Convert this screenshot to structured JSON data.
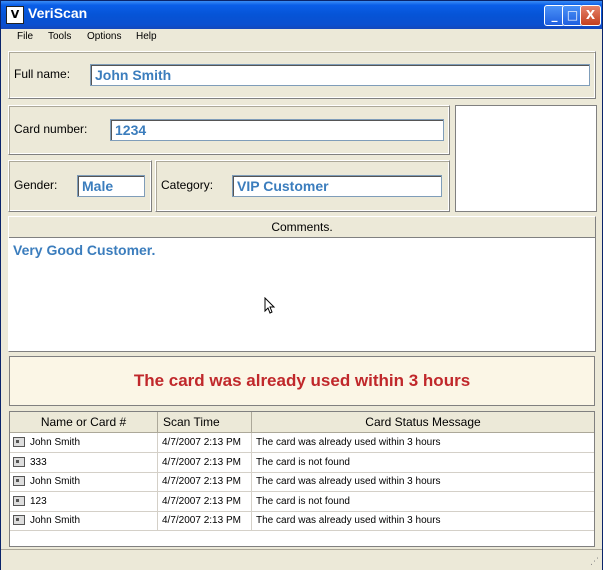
{
  "window": {
    "title": "VeriScan",
    "icon": "veriscan-app-icon",
    "minimize_glyph": "_",
    "maximize_glyph": "□",
    "close_glyph": "X"
  },
  "menu": {
    "items": [
      "File",
      "Tools",
      "Options",
      "Help"
    ]
  },
  "form": {
    "fullname_label": "Full name:",
    "fullname_value": "John Smith",
    "card_label": "Card number:",
    "card_value": "1234",
    "gender_label": "Gender:",
    "gender_value": "Male",
    "category_label": "Category:",
    "category_value": "VIP Customer"
  },
  "comments": {
    "header": "Comments.",
    "text": "Very Good Customer."
  },
  "alert": {
    "message": "The card was already used within 3 hours",
    "color": "#c0282b"
  },
  "table": {
    "columns": [
      "Name or Card #",
      "Scan Time",
      "Card Status Message"
    ],
    "rows": [
      {
        "name": "John Smith",
        "time": "4/7/2007 2:13 PM",
        "status": "The card was already used within 3 hours"
      },
      {
        "name": "333",
        "time": "4/7/2007 2:13 PM",
        "status": "The card is not found"
      },
      {
        "name": "John Smith",
        "time": "4/7/2007 2:13 PM",
        "status": "The card was already used within 3 hours"
      },
      {
        "name": "123",
        "time": "4/7/2007 2:13 PM",
        "status": "The card is not found"
      },
      {
        "name": "John Smith",
        "time": "4/7/2007 2:13 PM",
        "status": "The card was already used within 3 hours"
      }
    ]
  },
  "colors": {
    "field_text": "#3b7dbd",
    "titlebar": "#0654d6"
  }
}
